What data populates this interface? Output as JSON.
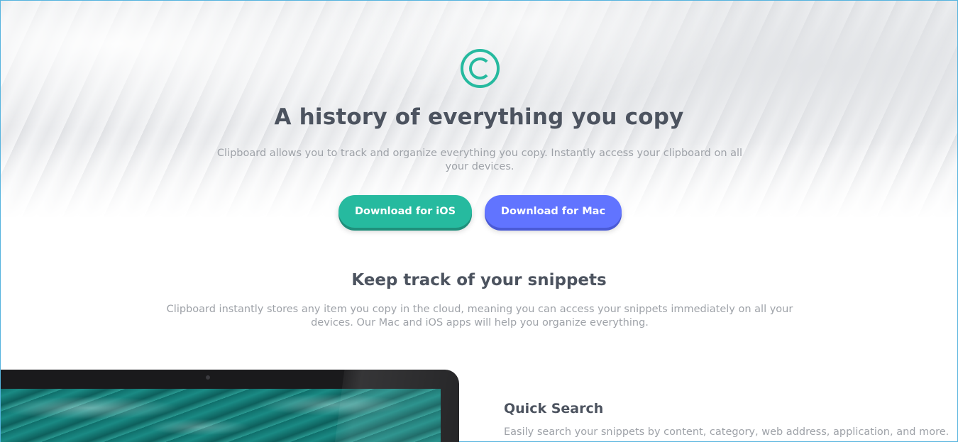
{
  "hero": {
    "logo_icon": "copyright-icon",
    "title": "A history of everything you copy",
    "subtitle": "Clipboard allows you to track and organize everything you copy. Instantly access your clipboard on all your devices.",
    "buttons": {
      "ios_label": "Download for iOS",
      "mac_label": "Download for Mac"
    }
  },
  "snippets": {
    "title": "Keep track of your snippets",
    "text": "Clipboard instantly stores any item you copy in the cloud, meaning you can access your snippets immediately on all your devices. Our Mac and iOS apps will help you organize everything."
  },
  "features": {
    "quick_search": {
      "title": "Quick Search",
      "text": "Easily search your snippets by content, category, web address, application, and more."
    }
  },
  "colors": {
    "accent_green": "#26ba9f",
    "accent_blue": "#6174ff",
    "heading": "#4c535f",
    "body_text": "#9ea2a8"
  }
}
